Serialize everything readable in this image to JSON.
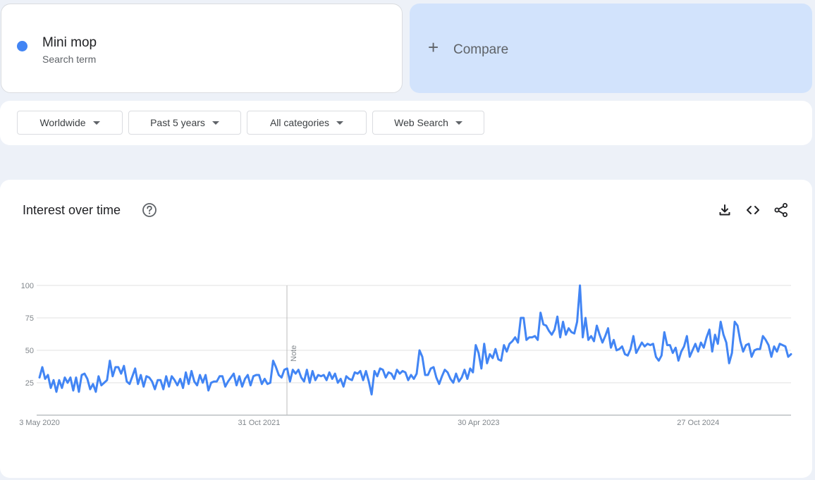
{
  "search_term": {
    "name": "Mini mop",
    "subtitle": "Search term",
    "color": "#4285f4"
  },
  "compare": {
    "label": "Compare",
    "icon": "plus-icon"
  },
  "filters": [
    {
      "label": "Worldwide"
    },
    {
      "label": "Past 5 years"
    },
    {
      "label": "All categories"
    },
    {
      "label": "Web Search"
    }
  ],
  "interest_panel": {
    "title": "Interest over time",
    "icons": [
      "help-icon",
      "download-icon",
      "embed-icon",
      "share-icon"
    ],
    "note_label": "Note"
  },
  "chart_data": {
    "type": "line",
    "y_ticks": [
      100,
      75,
      50,
      25
    ],
    "ylim": [
      0,
      100
    ],
    "x_tick_labels": [
      "3 May 2020",
      "31 Oct 2021",
      "30 Apr 2023",
      "27 Oct 2024"
    ],
    "series": [
      {
        "name": "Mini mop",
        "color": "#4285f4",
        "values": [
          29,
          37,
          28,
          31,
          21,
          27,
          18,
          27,
          21,
          29,
          25,
          29,
          19,
          29,
          18,
          31,
          32,
          28,
          20,
          24,
          18,
          30,
          23,
          25,
          27,
          42,
          30,
          37,
          37,
          32,
          38,
          26,
          24,
          30,
          36,
          24,
          31,
          22,
          30,
          29,
          26,
          20,
          27,
          27,
          20,
          30,
          22,
          30,
          27,
          23,
          28,
          21,
          33,
          24,
          34,
          26,
          23,
          31,
          25,
          31,
          19,
          25,
          26,
          26,
          30,
          30,
          22,
          26,
          29,
          32,
          23,
          30,
          22,
          28,
          31,
          23,
          30,
          31,
          31,
          24,
          28,
          24,
          25,
          42,
          37,
          31,
          29,
          35,
          36,
          26,
          35,
          32,
          35,
          29,
          26,
          35,
          25,
          34,
          27,
          31,
          30,
          31,
          27,
          33,
          28,
          32,
          25,
          28,
          22,
          30,
          28,
          27,
          33,
          32,
          34,
          27,
          34,
          26,
          16,
          34,
          30,
          36,
          35,
          29,
          33,
          32,
          28,
          35,
          32,
          34,
          33,
          27,
          31,
          28,
          32,
          50,
          45,
          31,
          31,
          36,
          37,
          29,
          24,
          30,
          35,
          33,
          28,
          25,
          32,
          26,
          29,
          35,
          28,
          36,
          33,
          54,
          48,
          36,
          55,
          40,
          47,
          44,
          51,
          43,
          42,
          54,
          49,
          55,
          57,
          60,
          56,
          75,
          75,
          58,
          60,
          60,
          61,
          58,
          79,
          70,
          69,
          65,
          62,
          66,
          76,
          60,
          72,
          62,
          67,
          64,
          63,
          72,
          100,
          60,
          75,
          58,
          61,
          57,
          69,
          62,
          56,
          61,
          67,
          52,
          58,
          50,
          51,
          53,
          47,
          46,
          51,
          61,
          48,
          52,
          56,
          53,
          55,
          54,
          55,
          45,
          42,
          46,
          64,
          54,
          54,
          48,
          52,
          42,
          49,
          53,
          61,
          45,
          50,
          55,
          49,
          56,
          52,
          60,
          66,
          49,
          62,
          55,
          72,
          62,
          56,
          40,
          48,
          72,
          69,
          57,
          49,
          54,
          55,
          45,
          50,
          51,
          51,
          61,
          58,
          54,
          45,
          53,
          49,
          55,
          54,
          53,
          45,
          47
        ]
      }
    ]
  }
}
